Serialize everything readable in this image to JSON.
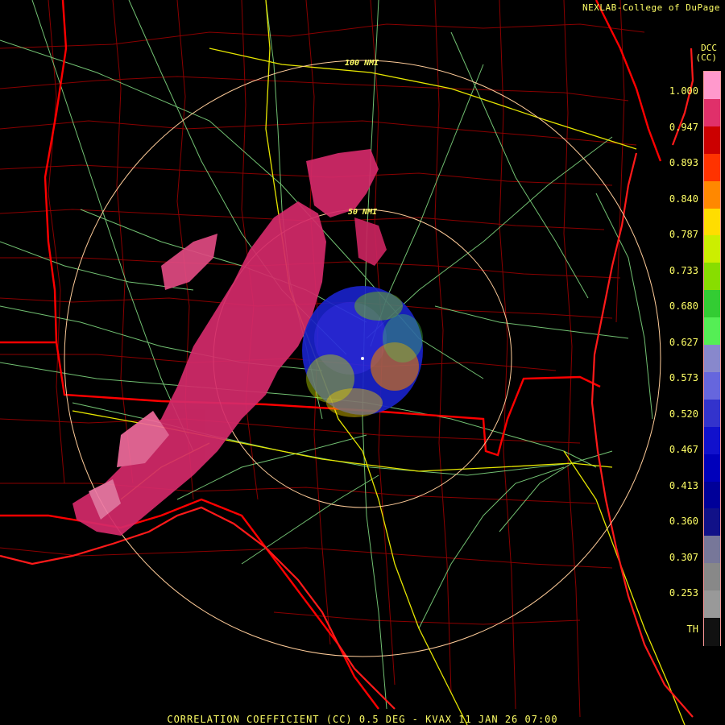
{
  "header": {
    "credit": "NEXLAB-College of DuPage",
    "product_code_line1": "DCC",
    "product_code_line2": "(CC)"
  },
  "footer": {
    "title": "CORRELATION COEFFICIENT (CC) 0.5 DEG - KVAX 11 JAN 26 07:00"
  },
  "range_rings": {
    "inner_label": "50 NMI",
    "outer_label": "100 NMI"
  },
  "legend": {
    "ticks": [
      "1.000",
      "0.947",
      "0.893",
      "0.840",
      "0.787",
      "0.733",
      "0.680",
      "0.627",
      "0.573",
      "0.520",
      "0.467",
      "0.413",
      "0.360",
      "0.307",
      "0.253",
      "TH"
    ],
    "colors": [
      "#ff99cc",
      "#e0306a",
      "#cc0000",
      "#ff3300",
      "#ff8800",
      "#ffdd00",
      "#ccee00",
      "#88dd00",
      "#33cc33",
      "#55ee55",
      "#8888cc",
      "#6666dd",
      "#3333cc",
      "#1111cc",
      "#0000bb",
      "#000099",
      "#111188",
      "#777799",
      "#888888",
      "#999999",
      "#111111"
    ],
    "border_color": "#ff9999"
  },
  "colors": {
    "state_border": "#ff0000",
    "county_line": "#990000",
    "highway": "#ffff00",
    "roads": "#88dd88",
    "range_ring": "#ffcc99",
    "text": "#ffff66",
    "background": "#000000"
  }
}
